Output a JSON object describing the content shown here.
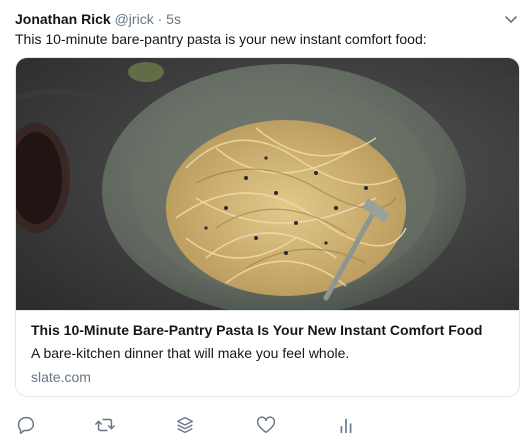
{
  "tweet": {
    "author_name": "Jonathan Rick",
    "handle": "@jrick",
    "separator": "·",
    "time": "5s",
    "text": "This 10-minute bare-pantry pasta is your new instant comfort food:"
  },
  "card": {
    "title": "This 10-Minute Bare-Pantry Pasta Is Your New Instant Comfort Food",
    "description": "A bare-kitchen dinner that will make you feel whole.",
    "domain": "slate.com",
    "image_icon": "pasta-plate-photo"
  },
  "actions": [
    {
      "icon": "reply-icon"
    },
    {
      "icon": "retweet-icon"
    },
    {
      "icon": "stack-icon"
    },
    {
      "icon": "like-icon"
    },
    {
      "icon": "analytics-icon"
    }
  ],
  "colors": {
    "text": "#14171a",
    "secondary": "#657786",
    "border": "#e1e8ed",
    "icon": "#657786"
  }
}
